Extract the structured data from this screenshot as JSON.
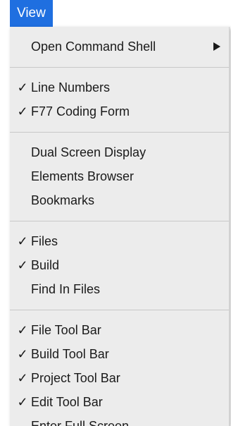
{
  "menubar": {
    "view_label": "View"
  },
  "menu": {
    "sections": [
      [
        {
          "label": "Open Command Shell",
          "checked": false,
          "submenu": true,
          "check_glyph": ""
        }
      ],
      [
        {
          "label": "Line Numbers",
          "checked": true,
          "check_glyph": "✓"
        },
        {
          "label": "F77 Coding Form",
          "checked": true,
          "check_glyph": "✓"
        }
      ],
      [
        {
          "label": "Dual Screen Display",
          "checked": false,
          "check_glyph": ""
        },
        {
          "label": "Elements Browser",
          "checked": false,
          "check_glyph": ""
        },
        {
          "label": "Bookmarks",
          "checked": false,
          "check_glyph": ""
        }
      ],
      [
        {
          "label": "Files",
          "checked": true,
          "check_glyph": "✓"
        },
        {
          "label": "Build",
          "checked": true,
          "check_glyph": "✓"
        },
        {
          "label": "Find In Files",
          "checked": false,
          "check_glyph": ""
        }
      ],
      [
        {
          "label": "File Tool Bar",
          "checked": true,
          "check_glyph": "✓"
        },
        {
          "label": "Build Tool Bar",
          "checked": true,
          "check_glyph": "✓"
        },
        {
          "label": "Project Tool Bar",
          "checked": true,
          "check_glyph": "✓"
        },
        {
          "label": "Edit Tool Bar",
          "checked": true,
          "check_glyph": "✓"
        },
        {
          "label": "Enter Full Screen",
          "checked": false,
          "check_glyph": ""
        }
      ]
    ]
  },
  "colors": {
    "menubar_highlight": "#1f6fe0",
    "menu_background": "#ececec",
    "separator": "#c8c8c8"
  },
  "icons": {
    "checkmark": "checkmark-icon",
    "submenu": "submenu-arrow-icon"
  }
}
